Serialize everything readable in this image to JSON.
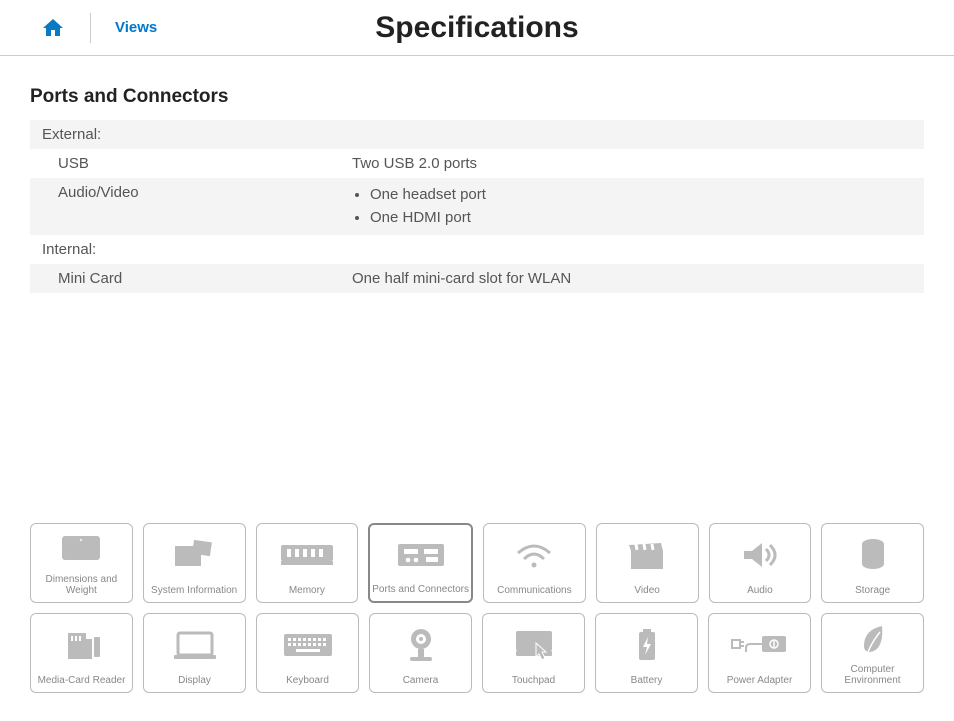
{
  "topbar": {
    "views_label": "Views",
    "page_title": "Specifications"
  },
  "section": {
    "title": "Ports and Connectors",
    "external_header": "External:",
    "usb_label": "USB",
    "usb_value": "Two USB 2.0 ports",
    "av_label": "Audio/Video",
    "av_bullet1": "One headset port",
    "av_bullet2": "One HDMI port",
    "internal_header": "Internal:",
    "minicard_label": "Mini Card",
    "minicard_value": "One half mini-card slot for WLAN"
  },
  "nav": {
    "r1": {
      "c0": "Dimensions and Weight",
      "c1": "System Information",
      "c2": "Memory",
      "c3": "Ports and Connectors",
      "c4": "Communications",
      "c5": "Video",
      "c6": "Audio",
      "c7": "Storage"
    },
    "r2": {
      "c0": "Media-Card Reader",
      "c1": "Display",
      "c2": "Keyboard",
      "c3": "Camera",
      "c4": "Touchpad",
      "c5": "Battery",
      "c6": "Power Adapter",
      "c7": "Computer Environment"
    }
  }
}
